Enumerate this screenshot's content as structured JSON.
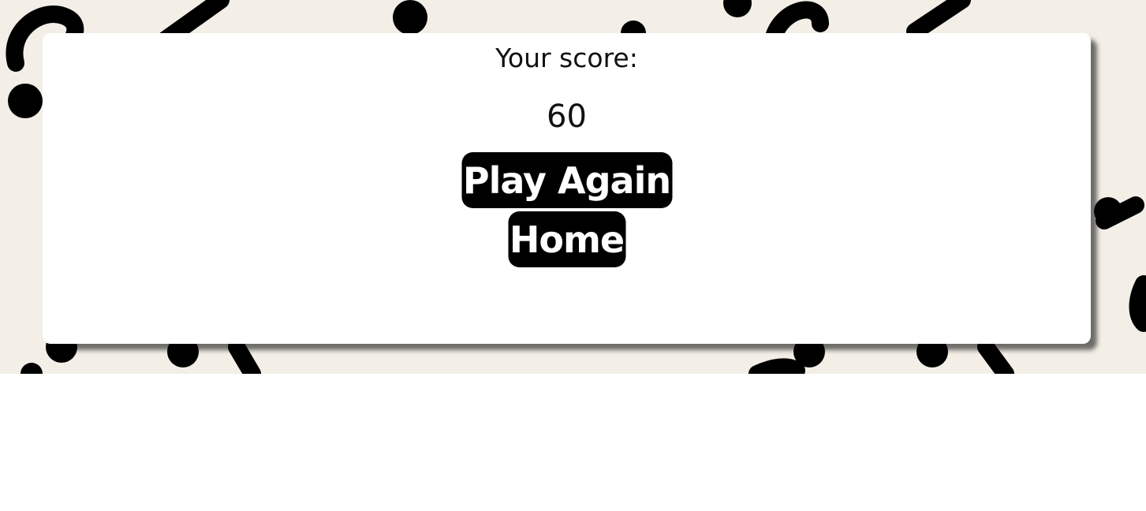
{
  "result": {
    "score_label": "Your score:",
    "score_value": "60",
    "play_again_label": "Play Again",
    "home_label": "Home"
  },
  "theme": {
    "background": "#f3efe7",
    "card": "#ffffff",
    "button": "#000000",
    "button_text": "#ffffff"
  },
  "decorations": {
    "icon": "question-mark-icon"
  }
}
